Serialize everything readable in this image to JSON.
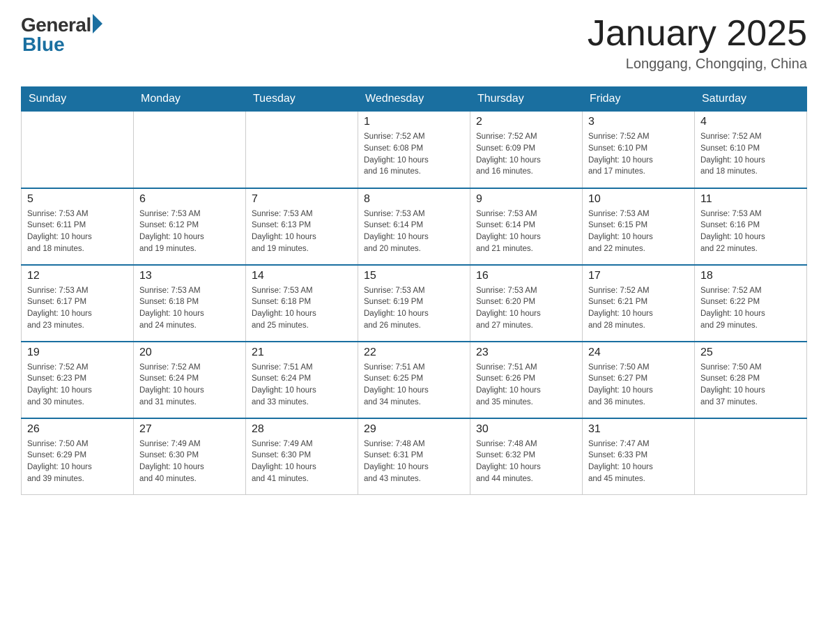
{
  "header": {
    "logo_general": "General",
    "logo_blue": "Blue",
    "title": "January 2025",
    "subtitle": "Longgang, Chongqing, China"
  },
  "weekdays": [
    "Sunday",
    "Monday",
    "Tuesday",
    "Wednesday",
    "Thursday",
    "Friday",
    "Saturday"
  ],
  "weeks": [
    [
      {
        "day": "",
        "info": ""
      },
      {
        "day": "",
        "info": ""
      },
      {
        "day": "",
        "info": ""
      },
      {
        "day": "1",
        "info": "Sunrise: 7:52 AM\nSunset: 6:08 PM\nDaylight: 10 hours\nand 16 minutes."
      },
      {
        "day": "2",
        "info": "Sunrise: 7:52 AM\nSunset: 6:09 PM\nDaylight: 10 hours\nand 16 minutes."
      },
      {
        "day": "3",
        "info": "Sunrise: 7:52 AM\nSunset: 6:10 PM\nDaylight: 10 hours\nand 17 minutes."
      },
      {
        "day": "4",
        "info": "Sunrise: 7:52 AM\nSunset: 6:10 PM\nDaylight: 10 hours\nand 18 minutes."
      }
    ],
    [
      {
        "day": "5",
        "info": "Sunrise: 7:53 AM\nSunset: 6:11 PM\nDaylight: 10 hours\nand 18 minutes."
      },
      {
        "day": "6",
        "info": "Sunrise: 7:53 AM\nSunset: 6:12 PM\nDaylight: 10 hours\nand 19 minutes."
      },
      {
        "day": "7",
        "info": "Sunrise: 7:53 AM\nSunset: 6:13 PM\nDaylight: 10 hours\nand 19 minutes."
      },
      {
        "day": "8",
        "info": "Sunrise: 7:53 AM\nSunset: 6:14 PM\nDaylight: 10 hours\nand 20 minutes."
      },
      {
        "day": "9",
        "info": "Sunrise: 7:53 AM\nSunset: 6:14 PM\nDaylight: 10 hours\nand 21 minutes."
      },
      {
        "day": "10",
        "info": "Sunrise: 7:53 AM\nSunset: 6:15 PM\nDaylight: 10 hours\nand 22 minutes."
      },
      {
        "day": "11",
        "info": "Sunrise: 7:53 AM\nSunset: 6:16 PM\nDaylight: 10 hours\nand 22 minutes."
      }
    ],
    [
      {
        "day": "12",
        "info": "Sunrise: 7:53 AM\nSunset: 6:17 PM\nDaylight: 10 hours\nand 23 minutes."
      },
      {
        "day": "13",
        "info": "Sunrise: 7:53 AM\nSunset: 6:18 PM\nDaylight: 10 hours\nand 24 minutes."
      },
      {
        "day": "14",
        "info": "Sunrise: 7:53 AM\nSunset: 6:18 PM\nDaylight: 10 hours\nand 25 minutes."
      },
      {
        "day": "15",
        "info": "Sunrise: 7:53 AM\nSunset: 6:19 PM\nDaylight: 10 hours\nand 26 minutes."
      },
      {
        "day": "16",
        "info": "Sunrise: 7:53 AM\nSunset: 6:20 PM\nDaylight: 10 hours\nand 27 minutes."
      },
      {
        "day": "17",
        "info": "Sunrise: 7:52 AM\nSunset: 6:21 PM\nDaylight: 10 hours\nand 28 minutes."
      },
      {
        "day": "18",
        "info": "Sunrise: 7:52 AM\nSunset: 6:22 PM\nDaylight: 10 hours\nand 29 minutes."
      }
    ],
    [
      {
        "day": "19",
        "info": "Sunrise: 7:52 AM\nSunset: 6:23 PM\nDaylight: 10 hours\nand 30 minutes."
      },
      {
        "day": "20",
        "info": "Sunrise: 7:52 AM\nSunset: 6:24 PM\nDaylight: 10 hours\nand 31 minutes."
      },
      {
        "day": "21",
        "info": "Sunrise: 7:51 AM\nSunset: 6:24 PM\nDaylight: 10 hours\nand 33 minutes."
      },
      {
        "day": "22",
        "info": "Sunrise: 7:51 AM\nSunset: 6:25 PM\nDaylight: 10 hours\nand 34 minutes."
      },
      {
        "day": "23",
        "info": "Sunrise: 7:51 AM\nSunset: 6:26 PM\nDaylight: 10 hours\nand 35 minutes."
      },
      {
        "day": "24",
        "info": "Sunrise: 7:50 AM\nSunset: 6:27 PM\nDaylight: 10 hours\nand 36 minutes."
      },
      {
        "day": "25",
        "info": "Sunrise: 7:50 AM\nSunset: 6:28 PM\nDaylight: 10 hours\nand 37 minutes."
      }
    ],
    [
      {
        "day": "26",
        "info": "Sunrise: 7:50 AM\nSunset: 6:29 PM\nDaylight: 10 hours\nand 39 minutes."
      },
      {
        "day": "27",
        "info": "Sunrise: 7:49 AM\nSunset: 6:30 PM\nDaylight: 10 hours\nand 40 minutes."
      },
      {
        "day": "28",
        "info": "Sunrise: 7:49 AM\nSunset: 6:30 PM\nDaylight: 10 hours\nand 41 minutes."
      },
      {
        "day": "29",
        "info": "Sunrise: 7:48 AM\nSunset: 6:31 PM\nDaylight: 10 hours\nand 43 minutes."
      },
      {
        "day": "30",
        "info": "Sunrise: 7:48 AM\nSunset: 6:32 PM\nDaylight: 10 hours\nand 44 minutes."
      },
      {
        "day": "31",
        "info": "Sunrise: 7:47 AM\nSunset: 6:33 PM\nDaylight: 10 hours\nand 45 minutes."
      },
      {
        "day": "",
        "info": ""
      }
    ]
  ]
}
